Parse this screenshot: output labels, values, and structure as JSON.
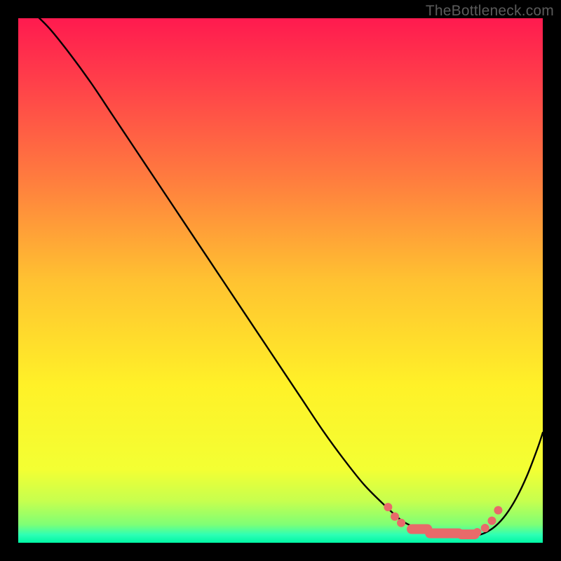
{
  "watermark": "TheBottleneck.com",
  "chart_data": {
    "type": "line",
    "title": "",
    "xlabel": "",
    "ylabel": "",
    "xlim": [
      0,
      100
    ],
    "ylim": [
      0,
      100
    ],
    "background": {
      "type": "vertical-gradient",
      "stops": [
        {
          "pos": 0.0,
          "color": "#ff1a4f"
        },
        {
          "pos": 0.12,
          "color": "#ff3f4a"
        },
        {
          "pos": 0.3,
          "color": "#ff7a3f"
        },
        {
          "pos": 0.5,
          "color": "#ffc231"
        },
        {
          "pos": 0.7,
          "color": "#fff128"
        },
        {
          "pos": 0.86,
          "color": "#f3ff33"
        },
        {
          "pos": 0.92,
          "color": "#c7ff4e"
        },
        {
          "pos": 0.965,
          "color": "#7fff75"
        },
        {
          "pos": 0.985,
          "color": "#2dffb5"
        },
        {
          "pos": 1.0,
          "color": "#00f6a4"
        }
      ]
    },
    "series": [
      {
        "name": "curve",
        "color": "#000000",
        "x": [
          0,
          3,
          6,
          10,
          14,
          18,
          22,
          26,
          30,
          34,
          38,
          42,
          46,
          50,
          54,
          58,
          62,
          66,
          70,
          73,
          75,
          77,
          79,
          81,
          83,
          85,
          87,
          89,
          91,
          93,
          95,
          97,
          99,
          100
        ],
        "y": [
          104,
          101,
          98,
          93,
          87.5,
          81.5,
          75.5,
          69.5,
          63.5,
          57.5,
          51.5,
          45.5,
          39.5,
          33.5,
          27.5,
          21.5,
          16,
          11,
          7,
          4.3,
          3.2,
          2.3,
          1.7,
          1.3,
          1.1,
          1.1,
          1.3,
          1.9,
          3.2,
          5.4,
          8.6,
          12.8,
          18.0,
          21.0
        ]
      }
    ],
    "markers": {
      "name": "highlight-dots",
      "color": "#e86a6a",
      "dot_r": 6,
      "pill_r": 7,
      "points": [
        {
          "x": 70.5,
          "y": 6.8,
          "type": "dot"
        },
        {
          "x": 71.8,
          "y": 5.0,
          "type": "dot"
        },
        {
          "x": 73.0,
          "y": 3.8,
          "type": "dot"
        },
        {
          "x": 75.0,
          "y": 2.6,
          "type": "pill",
          "x2": 78.0
        },
        {
          "x": 78.5,
          "y": 1.8,
          "type": "pill",
          "x2": 84.0
        },
        {
          "x": 84.5,
          "y": 1.6,
          "type": "pill",
          "x2": 87.0
        },
        {
          "x": 87.5,
          "y": 2.0,
          "type": "dot"
        },
        {
          "x": 89.0,
          "y": 2.8,
          "type": "dot"
        },
        {
          "x": 90.3,
          "y": 4.2,
          "type": "dot"
        },
        {
          "x": 91.5,
          "y": 6.2,
          "type": "dot"
        }
      ]
    }
  }
}
